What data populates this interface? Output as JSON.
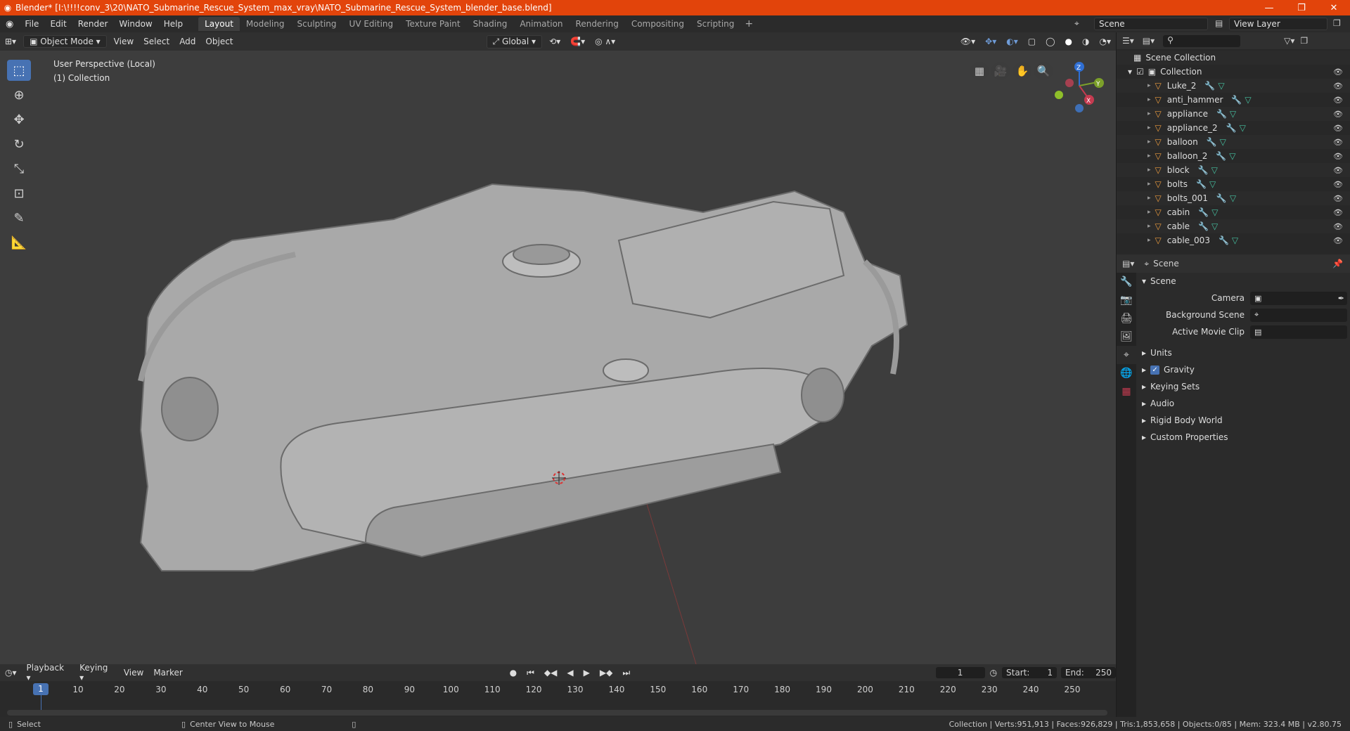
{
  "window": {
    "title": "Blender* [I:\\!!!!conv_3\\20\\NATO_Submarine_Rescue_System_max_vray\\NATO_Submarine_Rescue_System_blender_base.blend]"
  },
  "menu": [
    "File",
    "Edit",
    "Render",
    "Window",
    "Help"
  ],
  "workspaces": [
    "Layout",
    "Modeling",
    "Sculpting",
    "UV Editing",
    "Texture Paint",
    "Shading",
    "Animation",
    "Rendering",
    "Compositing",
    "Scripting"
  ],
  "active_workspace": "Layout",
  "scene_name": "Scene",
  "view_layer": "View Layer",
  "viewport_header": {
    "mode": "Object Mode",
    "menus": [
      "View",
      "Select",
      "Add",
      "Object"
    ],
    "transform_orientation": "Global"
  },
  "viewport": {
    "perspective_label": "User Perspective (Local)",
    "collection_label": "(1) Collection",
    "axes": {
      "x": "X",
      "y": "Y",
      "z": "Z"
    }
  },
  "outliner": {
    "root": "Scene Collection",
    "collection": "Collection",
    "items": [
      "Luke_2",
      "anti_hammer",
      "appliance",
      "appliance_2",
      "balloon",
      "balloon_2",
      "block",
      "bolts",
      "bolts_001",
      "cabin",
      "cable",
      "cable_003"
    ]
  },
  "properties": {
    "header_title": "Scene",
    "section": "Scene",
    "fields": [
      {
        "label": "Camera",
        "value": ""
      },
      {
        "label": "Background Scene",
        "value": ""
      },
      {
        "label": "Active Movie Clip",
        "value": ""
      }
    ],
    "panels": [
      "Units",
      "Gravity",
      "Keying Sets",
      "Audio",
      "Rigid Body World",
      "Custom Properties"
    ],
    "gravity_checked": true
  },
  "timeline": {
    "menus": [
      "Playback",
      "Keying",
      "View",
      "Marker"
    ],
    "current_frame": "1",
    "start_label": "Start:",
    "start": "1",
    "end_label": "End:",
    "end": "250",
    "ticks": [
      "1",
      "10",
      "20",
      "30",
      "40",
      "50",
      "60",
      "70",
      "80",
      "90",
      "100",
      "110",
      "120",
      "130",
      "140",
      "150",
      "160",
      "170",
      "180",
      "190",
      "200",
      "210",
      "220",
      "230",
      "240",
      "250"
    ]
  },
  "statusbar": {
    "left_action": "Select",
    "middle_action": "Center View to Mouse",
    "stats": "Collection | Verts:951,913 | Faces:926,829 | Tris:1,853,658 | Objects:0/85 | Mem: 323.4 MB | v2.80.75"
  }
}
